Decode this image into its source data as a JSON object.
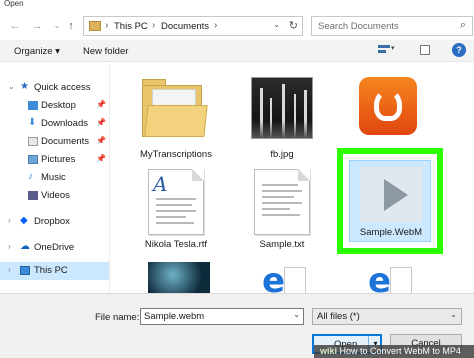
{
  "window": {
    "title": "Open"
  },
  "address": {
    "crumbs": [
      "This PC",
      "Documents"
    ]
  },
  "search": {
    "placeholder": "Search Documents"
  },
  "toolbar": {
    "organize_label": "Organize ▾",
    "new_folder_label": "New folder",
    "help_label": "?"
  },
  "sidebar": {
    "items": [
      {
        "label": "Quick access",
        "icon": "star-icon",
        "pinned": false
      },
      {
        "label": "Desktop",
        "icon": "desktop-icon",
        "pinned": true
      },
      {
        "label": "Downloads",
        "icon": "download-icon",
        "pinned": true
      },
      {
        "label": "Documents",
        "icon": "documents-icon",
        "pinned": true
      },
      {
        "label": "Pictures",
        "icon": "pictures-icon",
        "pinned": true
      },
      {
        "label": "Music",
        "icon": "music-icon",
        "pinned": false
      },
      {
        "label": "Videos",
        "icon": "videos-icon",
        "pinned": false
      },
      {
        "label": "Dropbox",
        "icon": "dropbox-icon",
        "pinned": false
      },
      {
        "label": "OneDrive",
        "icon": "onedrive-icon",
        "pinned": false
      },
      {
        "label": "This PC",
        "icon": "pc-icon",
        "pinned": false,
        "selected": true
      }
    ]
  },
  "files": [
    {
      "name": "MyTranscriptions",
      "kind": "folder"
    },
    {
      "name": "fb.jpg",
      "kind": "image"
    },
    {
      "name": "",
      "kind": "uc-browser-app"
    },
    {
      "name": "Nikola Tesla.rtf",
      "kind": "rtf-document"
    },
    {
      "name": "Sample.txt",
      "kind": "text-document"
    },
    {
      "name": "Sample.WebM",
      "kind": "video",
      "selected": true
    }
  ],
  "bottom": {
    "file_name_label": "File name:",
    "file_name_value": "Sample.webm",
    "file_type": "All files (*)",
    "open_label": "Open",
    "cancel_label": "Cancel"
  },
  "watermark": {
    "brand": "wiki",
    "text": "How to Convert WebM to MP4"
  },
  "colors": {
    "highlight": "#2bff00",
    "selection": "#cce8ff",
    "accent": "#0078d7"
  }
}
